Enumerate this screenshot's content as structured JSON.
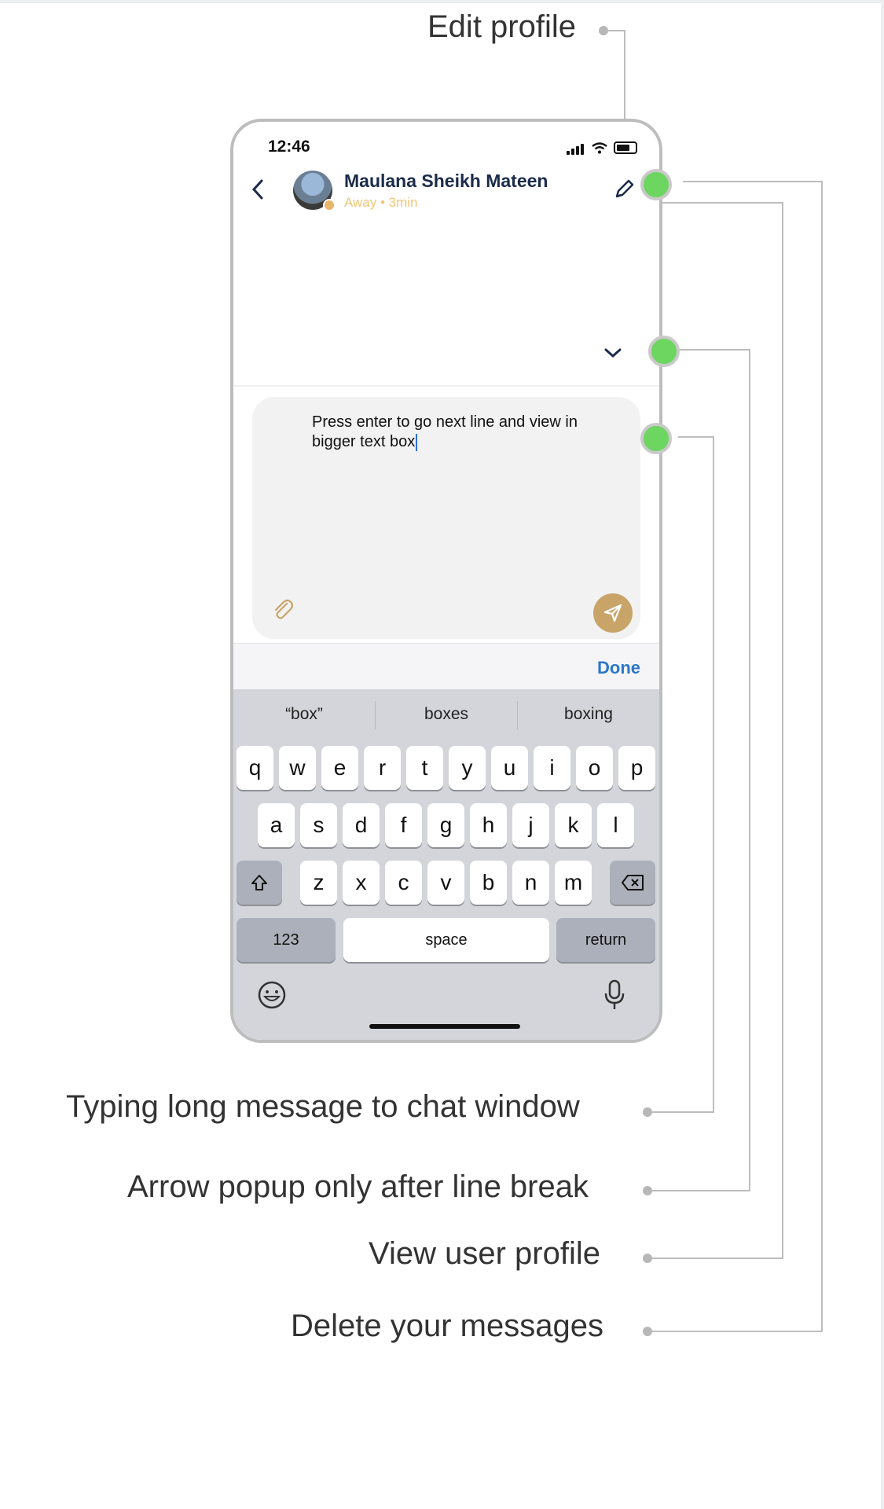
{
  "annotations": {
    "edit_profile": "Edit profile",
    "typing_long": "Typing long message to chat window",
    "arrow_popup": "Arrow popup only after line break",
    "view_profile": "View user profile",
    "delete_messages": "Delete your messages"
  },
  "status_bar": {
    "time": "12:46"
  },
  "chat_header": {
    "name": "Maulana Sheikh Mateen",
    "status": "Away • 3min",
    "back_icon": "chevron-left-icon",
    "edit_icon": "pencil-icon"
  },
  "composer": {
    "text": "Press enter to go next line and view in bigger text box",
    "attach_icon": "paperclip-icon",
    "send_icon": "paper-plane-icon"
  },
  "keyboard": {
    "done_label": "Done",
    "suggestions": [
      "“box”",
      "boxes",
      "boxing"
    ],
    "row1": [
      "q",
      "w",
      "e",
      "r",
      "t",
      "y",
      "u",
      "i",
      "o",
      "p"
    ],
    "row2": [
      "a",
      "s",
      "d",
      "f",
      "g",
      "h",
      "j",
      "k",
      "l"
    ],
    "row3": [
      "z",
      "x",
      "c",
      "v",
      "b",
      "n",
      "m"
    ],
    "numbers_label": "123",
    "space_label": "space",
    "return_label": "return",
    "emoji_icon": "emoji-icon",
    "mic_icon": "microphone-icon"
  },
  "colors": {
    "accent_green": "#6cd660",
    "send_button": "#c9a469",
    "done_blue": "#2a77c9",
    "name_navy": "#1b2b4b",
    "status_yellow": "#f0c675"
  }
}
